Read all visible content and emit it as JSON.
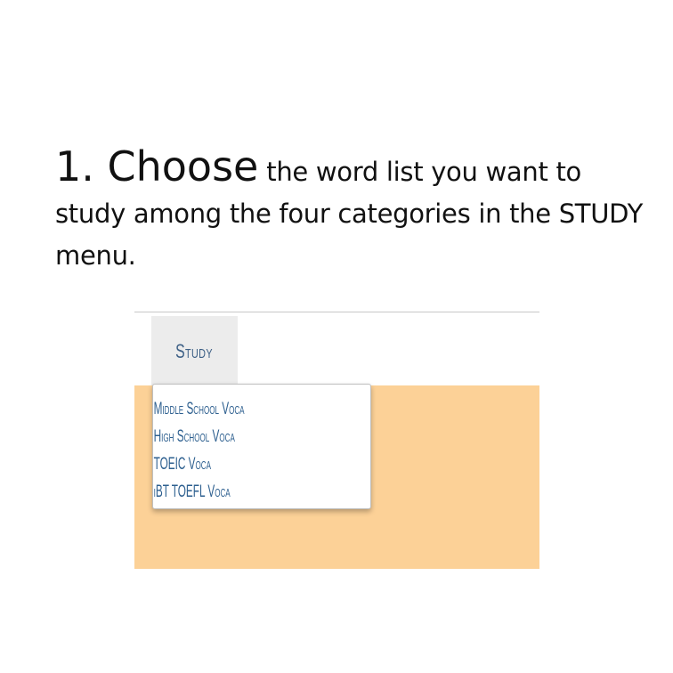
{
  "instruction": {
    "lead": "1. Choose",
    "rest": "the word list you want to study among the four categories in the STUDY menu."
  },
  "nav": {
    "study_label": "Study"
  },
  "dropdown": {
    "items": [
      {
        "label": "Middle School Voca"
      },
      {
        "label": "High School Voca"
      },
      {
        "label": "TOEIC Voca"
      },
      {
        "label": "iBT TOEFL Voca"
      }
    ]
  },
  "colors": {
    "content_background": "#fcd197",
    "menu_text": "#2d5f8f",
    "nav_active_background": "#ececec"
  }
}
